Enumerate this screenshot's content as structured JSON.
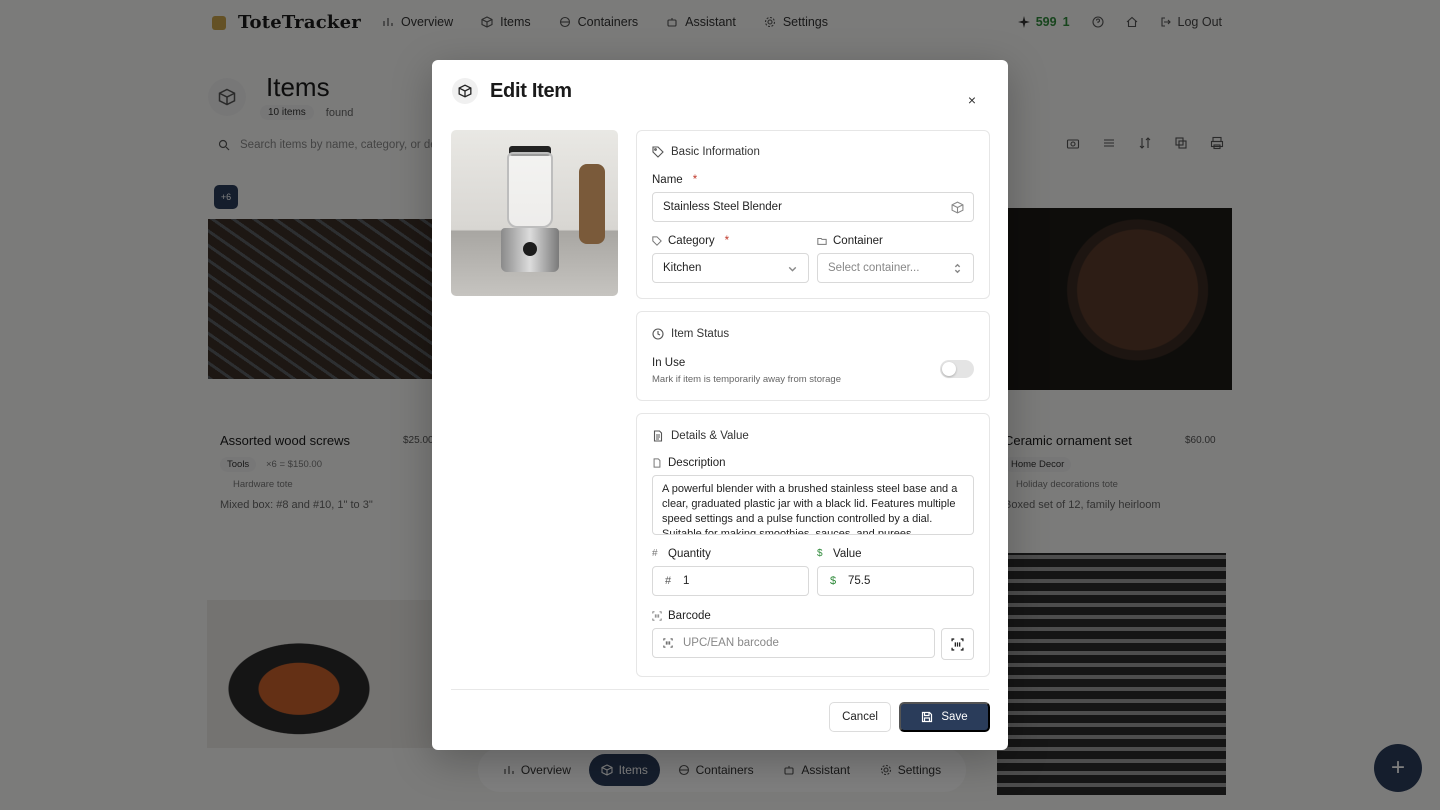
{
  "app": {
    "brand": "ToteTracker",
    "nav": [
      {
        "label": "Overview",
        "icon": "chart-icon"
      },
      {
        "label": "Items",
        "icon": "box-icon"
      },
      {
        "label": "Containers",
        "icon": "container-icon"
      },
      {
        "label": "Assistant",
        "icon": "bot-icon"
      },
      {
        "label": "Settings",
        "icon": "gear-icon"
      }
    ],
    "credits": "599",
    "credits_extra": "1",
    "logout": "Log Out"
  },
  "page": {
    "title": "Items",
    "count": "10 items",
    "count_suffix": "found",
    "search_placeholder": "Search items by name, category, or desc",
    "selected_badge": "+6"
  },
  "cards": [
    {
      "title": "Assorted wood screws",
      "price": "$25.00",
      "category": "Tools",
      "total": "×6 = $150.00",
      "container": "Hardware tote",
      "desc": "Mixed box: #8 and #10, 1\" to 3\""
    },
    {
      "title": "Ceramic ornament set",
      "price": "$60.00",
      "category": "Home Decor",
      "container": "Holiday decorations tote",
      "desc": "Boxed set of 12, family heirloom"
    }
  ],
  "bottom_nav": [
    {
      "label": "Overview"
    },
    {
      "label": "Items"
    },
    {
      "label": "Containers"
    },
    {
      "label": "Assistant"
    },
    {
      "label": "Settings"
    }
  ],
  "fab": "+",
  "modal": {
    "title": "Edit Item",
    "close": "×",
    "basic": {
      "title": "Basic Information",
      "name_label": "Name",
      "name_value": "Stainless Steel Blender",
      "category_label": "Category",
      "category_value": "Kitchen",
      "container_label": "Container",
      "container_placeholder": "Select container..."
    },
    "status": {
      "title": "Item Status",
      "in_use_label": "In Use",
      "in_use_hint": "Mark if item is temporarily away from storage",
      "in_use_on": false
    },
    "details": {
      "title": "Details & Value",
      "description_label": "Description",
      "description_value": "A powerful blender with a brushed stainless steel base and a clear, graduated plastic jar with a black lid. Features multiple speed settings and a pulse function controlled by a dial. Suitable for making smoothies, sauces, and purees.",
      "quantity_label": "Quantity",
      "quantity_value": "1",
      "value_label": "Value",
      "value_value": "75.5",
      "barcode_label": "Barcode",
      "barcode_placeholder": "UPC/EAN barcode"
    },
    "cancel": "Cancel",
    "save": "Save"
  },
  "colors": {
    "accent": "#2a3c5a",
    "credits": "#2f8a3a",
    "required": "#c0392b"
  }
}
